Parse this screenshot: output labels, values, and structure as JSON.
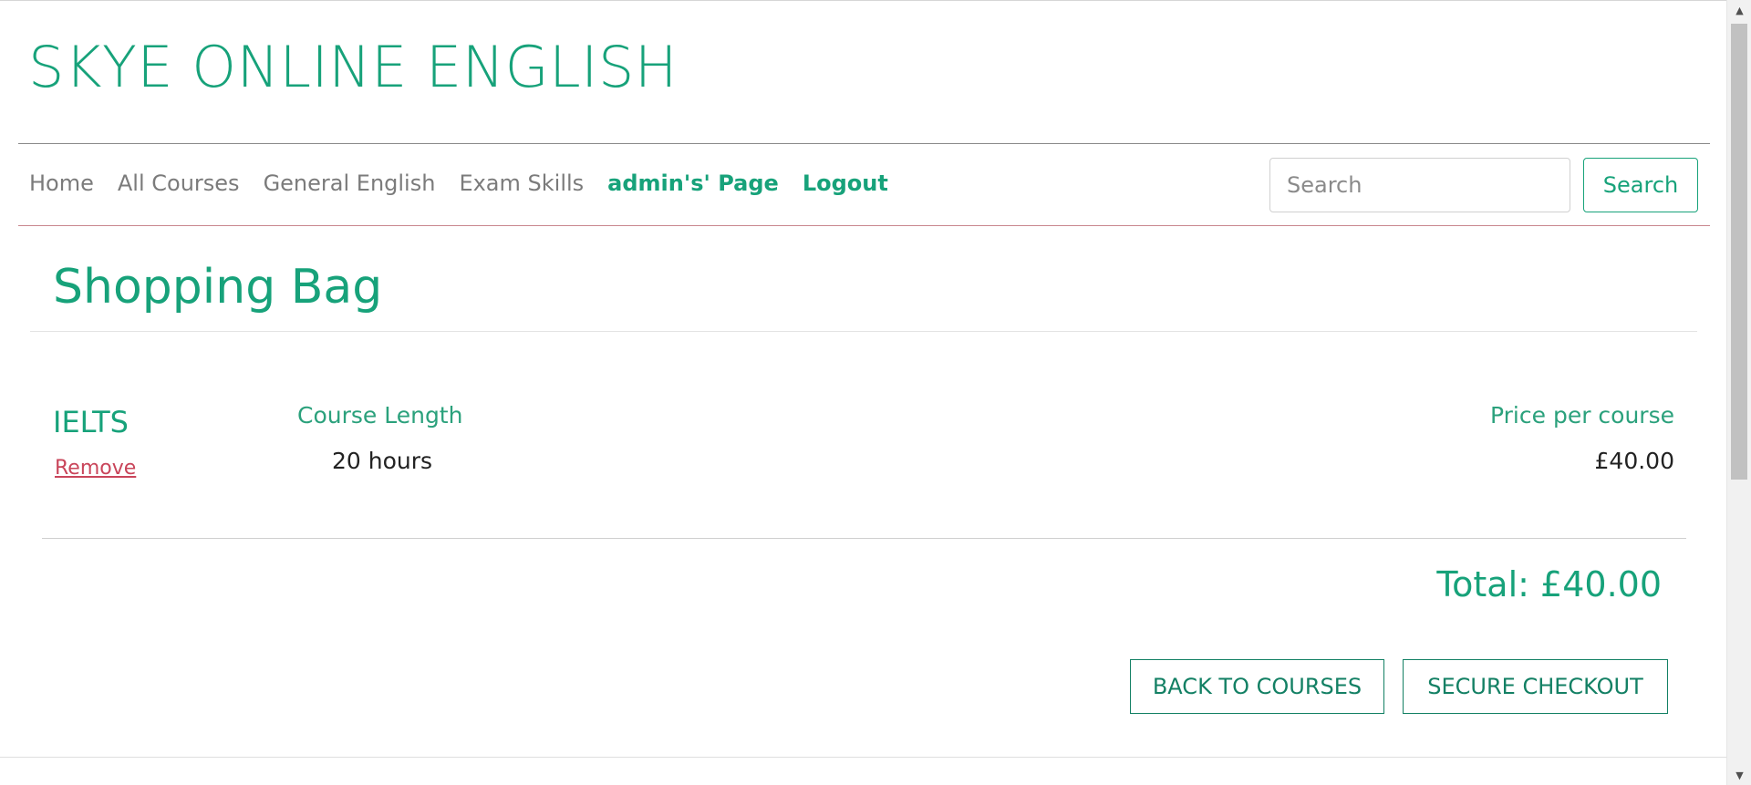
{
  "brand": {
    "title": "SKYE ONLINE ENGLISH"
  },
  "nav": {
    "items": [
      {
        "label": "Home"
      },
      {
        "label": "All Courses"
      },
      {
        "label": "General English"
      },
      {
        "label": "Exam Skills"
      },
      {
        "label": "admin's' Page"
      },
      {
        "label": "Logout"
      }
    ],
    "search_placeholder": "Search",
    "search_button": "Search"
  },
  "bag": {
    "title": "Shopping Bag",
    "item": {
      "name": "IELTS",
      "remove_label": "Remove",
      "length_label": "Course Length",
      "length_value": "20 hours",
      "price_label": "Price per course",
      "price_value": "£40.00"
    },
    "total": "Total: £40.00",
    "back_button": "BACK TO COURSES",
    "checkout_button": "SECURE CHECKOUT"
  },
  "colors": {
    "accent": "#17a27a",
    "danger": "#c9455a"
  },
  "icons": {
    "scroll_up": "up-arrow-icon",
    "scroll_down": "down-arrow-icon"
  }
}
